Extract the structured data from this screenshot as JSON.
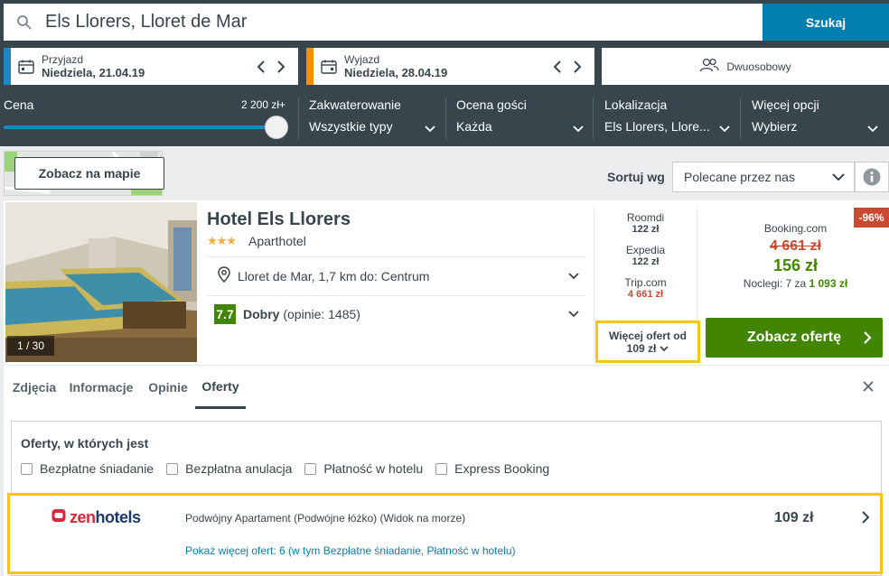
{
  "search": {
    "value": "Els Llorers, Lloret de Mar",
    "button_label": "Szukaj"
  },
  "dates": {
    "checkin_label": "Przyjazd",
    "checkin_value": "Niedziela, 21.04.19",
    "checkout_label": "Wyjazd",
    "checkout_value": "Niedziela, 28.04.19"
  },
  "guests": {
    "label": "Dwuosobowy"
  },
  "filters": {
    "price": {
      "title": "Cena",
      "max": "2 200 zł+",
      "level": 1.0
    },
    "accommodation": {
      "title": "Zakwaterowanie",
      "value": "Wszystkie typy"
    },
    "rating": {
      "title": "Ocena gości",
      "value": "Każda"
    },
    "location": {
      "title": "Lokalizacja",
      "value": "Els Llorers, Llore..."
    },
    "more": {
      "title": "Więcej opcji",
      "value": "Wybierz"
    }
  },
  "map": {
    "button_label": "Zobacz na mapie"
  },
  "sort": {
    "label": "Sortuj wg",
    "value": "Polecane przez nas"
  },
  "hotel": {
    "name": "Hotel Els Llorers",
    "stars": "★★★",
    "star_count": 3,
    "type": "Aparthotel",
    "location": "Lloret de Mar, 1,7 km do: Centrum",
    "rating_score": "7.7",
    "rating_word": "Dobry",
    "rating_count": "(opinie: 1485)",
    "photo_counter": "1 / 30"
  },
  "other_prices": [
    {
      "site": "Roomdi",
      "price": "122 zł",
      "highlight": false
    },
    {
      "site": "Expedia",
      "price": "122 zł",
      "highlight": false
    },
    {
      "site": "Trip.com",
      "price": "4 661 zł",
      "highlight": true
    }
  ],
  "more_offers": {
    "line1": "Więcej ofert od",
    "line2": "109 zł"
  },
  "deal": {
    "discount": "-96%",
    "site": "Booking.com",
    "old_price": "4 661 zł",
    "new_price": "156 zł",
    "nights_prefix": "Noclegi: 7 za",
    "nights_total": "1 093 zł",
    "cta_label": "Zobacz ofertę"
  },
  "tabs": [
    "Zdjęcia",
    "Informacje",
    "Opinie",
    "Oferty"
  ],
  "offers_panel": {
    "title": "Oferty, w których jest",
    "filters": [
      "Bezpłatne śniadanie",
      "Bezpłatna anulacja",
      "Płatność w hotelu",
      "Express Booking"
    ]
  },
  "offer": {
    "provider_part1": "zen",
    "provider_part2": "hotels",
    "description": "Podwójny Apartament (Podwójne łóżko) (Widok na morze)",
    "price": "109 zł",
    "more_link": "Pokaż więcej ofert: 6 (w tym Bezpłatne śniadanie, Płatność w hotelu)"
  },
  "colors": {
    "header_bg": "#37454d",
    "search_button": "#007faf",
    "checkin_stripe": "#1f88c4",
    "checkout_stripe": "#f48f00",
    "rating_green": "#428500",
    "price_red": "#c94a30",
    "highlight_yellow": "#fac515"
  }
}
